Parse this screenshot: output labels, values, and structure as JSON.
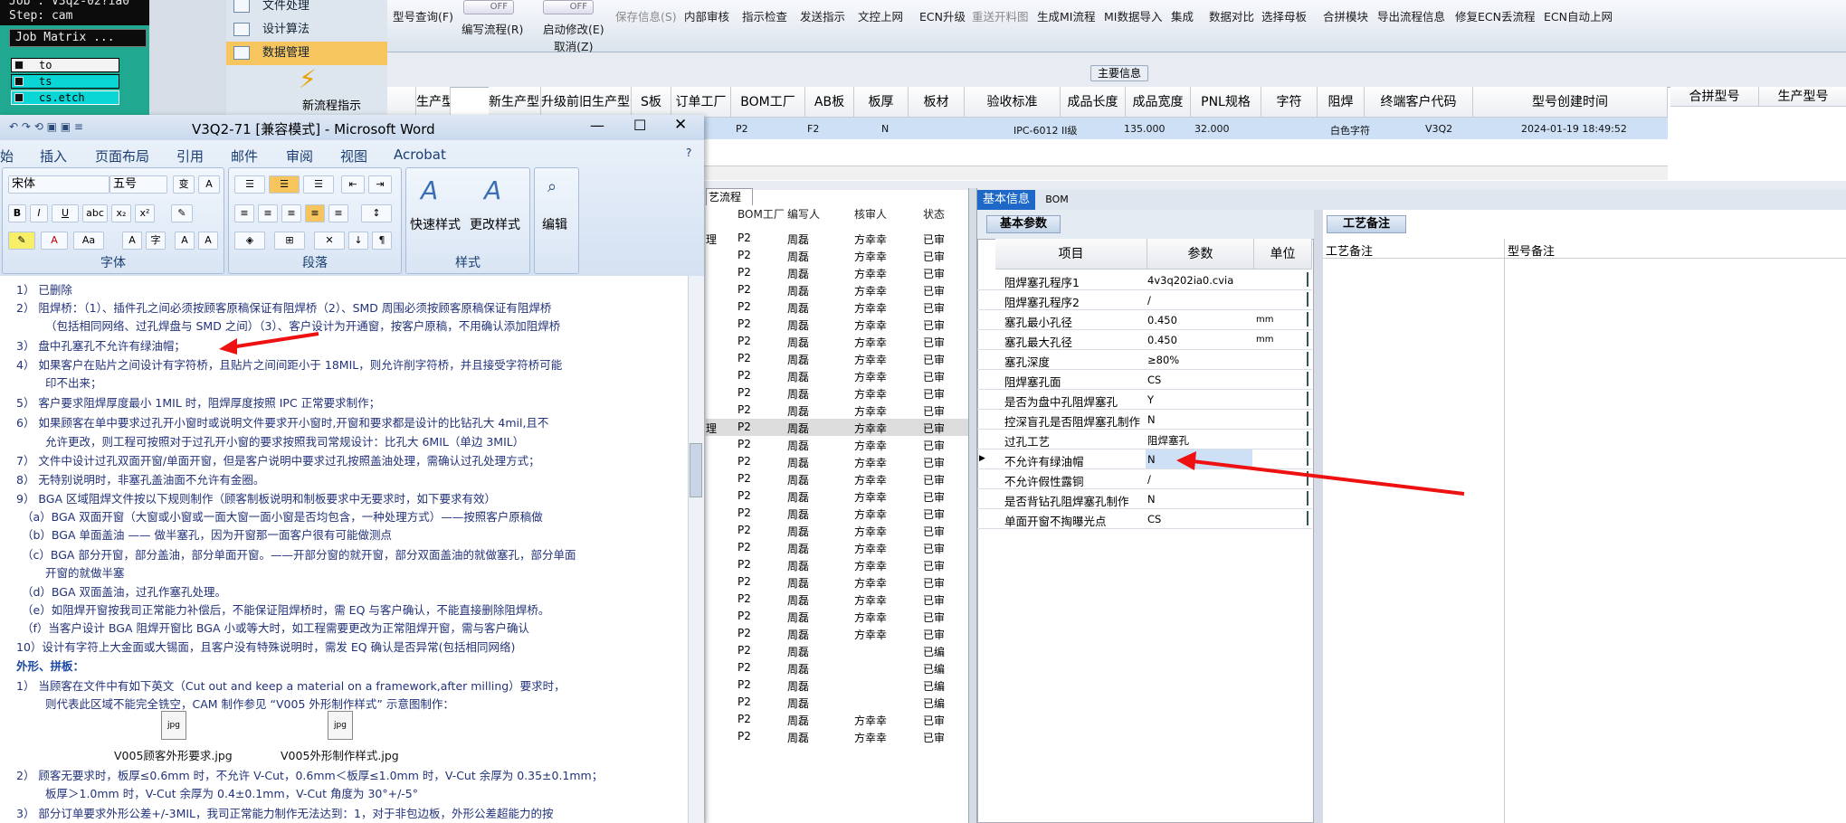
{
  "cam": {
    "job_line": "Job : V3q2-02?ia0",
    "step_line": "Step: cam",
    "job_matrix": "Job Matrix ...",
    "layers": [
      "to",
      "ts",
      "cs.etch"
    ]
  },
  "side_menu": {
    "items": [
      "文件处理",
      "设计算法",
      "数据管理"
    ],
    "new_flow": "新流程指示"
  },
  "toolbar": {
    "items": [
      {
        "label": "型号查询(F)",
        "disabled": false
      },
      {
        "label": "编写流程(R)",
        "disabled": false
      },
      {
        "label": "启动修改(E)\n取消(Z)",
        "disabled": false
      },
      {
        "label": "保存信息(S)",
        "disabled": true
      },
      {
        "label": "内部审核",
        "disabled": false
      },
      {
        "label": "指示检查",
        "disabled": false
      },
      {
        "label": "发送指示",
        "disabled": false
      },
      {
        "label": "文控上网",
        "disabled": false
      },
      {
        "label": "ECN升级",
        "disabled": false
      },
      {
        "label": "重送开料图",
        "disabled": true
      },
      {
        "label": "生成MI流程",
        "disabled": false
      },
      {
        "label": "MI数据导入",
        "disabled": false
      },
      {
        "label": "集成",
        "disabled": false
      },
      {
        "label": "数据对比",
        "disabled": false
      },
      {
        "label": "选择母板",
        "disabled": false
      },
      {
        "label": "合拼模块",
        "disabled": false
      },
      {
        "label": "导出流程信息",
        "disabled": false
      },
      {
        "label": "修复ECN丢流程",
        "disabled": false
      },
      {
        "label": "ECN自动上网",
        "disabled": false
      }
    ],
    "toggle_off": "OFF"
  },
  "main_info_label": "主要信息",
  "main_grid": {
    "headers": [
      "生产型号",
      "新生产型号",
      "升级前旧生产型号",
      "S板",
      "订单工厂",
      "BOM工厂",
      "AB板",
      "板厚",
      "板材",
      "验收标准",
      "成品长度",
      "成品宽度",
      "PNL规格",
      "字符",
      "阻焊",
      "终端客户代码",
      "型号创建时间"
    ],
    "right_headers": [
      "合拼型号",
      "生产型号"
    ],
    "row": {
      "s_board": "P2",
      "bom_factory": "F2",
      "ab": "N",
      "standard": "IPC-6012 II级",
      "length": "135.000",
      "width": "32.000",
      "character": "白色字符",
      "customer": "V3Q2",
      "created": "2024-01-19 18:49:52"
    }
  },
  "flow_list": {
    "tab": "艺流程",
    "headers": [
      "BOM工厂",
      "编写人",
      "核审人",
      "状态"
    ],
    "rows": [
      [
        "理",
        "P2",
        "周磊",
        "方幸幸",
        "已审"
      ],
      [
        "",
        "P2",
        "周磊",
        "方幸幸",
        "已审"
      ],
      [
        "",
        "P2",
        "周磊",
        "方幸幸",
        "已审"
      ],
      [
        "",
        "P2",
        "周磊",
        "方幸幸",
        "已审"
      ],
      [
        "",
        "P2",
        "周磊",
        "方幸幸",
        "已审"
      ],
      [
        "",
        "P2",
        "周磊",
        "方幸幸",
        "已审"
      ],
      [
        "",
        "P2",
        "周磊",
        "方幸幸",
        "已审"
      ],
      [
        "",
        "P2",
        "周磊",
        "方幸幸",
        "已审"
      ],
      [
        "",
        "P2",
        "周磊",
        "方幸幸",
        "已审"
      ],
      [
        "",
        "P2",
        "周磊",
        "方幸幸",
        "已审"
      ],
      [
        "",
        "P2",
        "周磊",
        "方幸幸",
        "已审"
      ],
      [
        "理",
        "P2",
        "周磊",
        "方幸幸",
        "已审"
      ],
      [
        "",
        "P2",
        "周磊",
        "方幸幸",
        "已审"
      ],
      [
        "",
        "P2",
        "周磊",
        "方幸幸",
        "已审"
      ],
      [
        "",
        "P2",
        "周磊",
        "方幸幸",
        "已审"
      ],
      [
        "",
        "P2",
        "周磊",
        "方幸幸",
        "已审"
      ],
      [
        "",
        "P2",
        "周磊",
        "方幸幸",
        "已审"
      ],
      [
        "",
        "P2",
        "周磊",
        "方幸幸",
        "已审"
      ],
      [
        "",
        "P2",
        "周磊",
        "方幸幸",
        "已审"
      ],
      [
        "",
        "P2",
        "周磊",
        "方幸幸",
        "已审"
      ],
      [
        "",
        "P2",
        "周磊",
        "方幸幸",
        "已审"
      ],
      [
        "",
        "P2",
        "周磊",
        "方幸幸",
        "已审"
      ],
      [
        "",
        "P2",
        "周磊",
        "方幸幸",
        "已审"
      ],
      [
        "",
        "P2",
        "周磊",
        "方幸幸",
        "已审"
      ],
      [
        "",
        "P2",
        "周磊",
        "",
        "已编"
      ],
      [
        "",
        "P2",
        "周磊",
        "",
        "已编"
      ],
      [
        "",
        "P2",
        "周磊",
        "",
        "已编"
      ],
      [
        "",
        "P2",
        "周磊",
        "",
        "已编"
      ],
      [
        "",
        "P2",
        "周磊",
        "方幸幸",
        "已审"
      ],
      [
        "",
        "P2",
        "周磊",
        "方幸幸",
        "已审"
      ]
    ]
  },
  "right_tabs": {
    "basic": "基本信息",
    "bom": "BOM"
  },
  "basic_params": {
    "subtab": "基本参数",
    "headers": [
      "项目",
      "参数",
      "单位"
    ],
    "rows": [
      {
        "k": "阻焊塞孔程序1",
        "v": "4v3q202ia0.cvia",
        "u": ""
      },
      {
        "k": "阻焊塞孔程序2",
        "v": "/",
        "u": ""
      },
      {
        "k": "塞孔最小孔径",
        "v": "0.450",
        "u": "mm"
      },
      {
        "k": "塞孔最大孔径",
        "v": "0.450",
        "u": "mm"
      },
      {
        "k": "塞孔深度",
        "v": "≥80%",
        "u": ""
      },
      {
        "k": "阻焊塞孔面",
        "v": "CS",
        "u": ""
      },
      {
        "k": "是否为盘中孔阻焊塞孔",
        "v": "Y",
        "u": ""
      },
      {
        "k": "控深盲孔是否阻焊塞孔制作",
        "v": "N",
        "u": ""
      },
      {
        "k": "过孔工艺",
        "v": "阻焊塞孔",
        "u": ""
      },
      {
        "k": "不允许有绿油帽",
        "v": "N",
        "u": ""
      },
      {
        "k": "不允许假性露铜",
        "v": "/",
        "u": ""
      },
      {
        "k": "是否背钻孔阻焊塞孔制作",
        "v": "N",
        "u": ""
      },
      {
        "k": "单面开窗不掏曝光点",
        "v": "CS",
        "u": ""
      }
    ]
  },
  "craft": {
    "tab": "工艺备注",
    "headers": [
      "工艺备注",
      "型号备注"
    ]
  },
  "word": {
    "title": "V3Q2-71 [兼容模式] - Microsoft Word",
    "tabs": [
      "始",
      "插入",
      "页面布局",
      "引用",
      "邮件",
      "审阅",
      "视图",
      "Acrobat"
    ],
    "font_name": "宋体",
    "font_size": "五号",
    "groups": [
      "字体",
      "段落",
      "样式"
    ],
    "style_buttons": [
      "快速样式",
      "更改样式",
      "编辑"
    ],
    "lines": [
      "1） 已删除",
      "2） 阻焊桥：（1）、插件孔之间必须按顾客原稿保证有阻焊桥（2）、SMD 周围必须按顾客原稿保证有阻焊桥",
      "（包括相同网络、过孔焊盘与 SMD 之间）（3）、客户设计为开通窗，按客户原稿，不用确认添加阻焊桥",
      "3） 盘中孔塞孔不允许有绿油帽；",
      "4） 如果客户在贴片之间设计有字符桥，且贴片之间间距小于 18MIL，则允许削字符桥，并且接受字符桥可能",
      "印不出来；",
      "5） 客户要求阻焊厚度最小 1MIL 时，阻焊厚度按照 IPC 正常要求制作；",
      "6） 如果顾客在单中要求过孔开小窗时或说明文件要求开小窗时,开窗和要求都是设计的比钻孔大 4mil,且不",
      "允许更改，则工程可按照对于过孔开小窗的要求按照我司常规设计：比孔大 6MIL（单边 3MIL）",
      "7） 文件中设计过孔双面开窗/单面开窗，但是客户说明中要求过孔按照盖油处理，需确认过孔处理方式；",
      "8） 无特别说明时，非塞孔盖油面不允许有金圈。",
      "9） BGA 区域阻焊文件按以下规则制作（顾客制板说明和制板要求中无要求时，如下要求有效）",
      "（a）BGA 双面开窗（大窗或小窗或一面大窗一面小窗是否均包含，一种处理方式）——按照客户原稿做",
      "（b）BGA 单面盖油 —— 做半塞孔，因为开窗那一面客户很有可能做测点",
      "（c）BGA 部分开窗，部分盖油，部分单面开窗。——开部分窗的就开窗，部分双面盖油的就做塞孔，部分单面",
      "开窗的就做半塞",
      "（d）BGA 双面盖油，过孔作塞孔处理。",
      "（e）如阻焊开窗按我司正常能力补偿后，不能保证阻焊桥时，需 EQ 与客户确认，不能直接删除阻焊桥。",
      "（f）当客户设计 BGA 阻焊开窗比 BGA 小或等大时，如工程需要更改为正常阻焊开窗，需与客户确认",
      "10）设计有字符上大金面或大锡面，且客户没有特殊说明时，需发 EQ 确认是否异常(包括相同网络)",
      "外形、拼板：",
      "1） 当顾客在文件中有如下英文（Cut out and keep a material on a framework,after milling）要求时，",
      "则代表此区域不能完全铣空，CAM 制作参见 “V005 外形制作样式” 示意图制作：",
      "V005顾客外形要求.jpg",
      "V005外形制作样式.jpg",
      "2） 顾客无要求时，板厚≤0.6mm 时，不允许 V-Cut，0.6mm＜板厚≤1.0mm 时，V-Cut 余厚为 0.35±0.1mm；",
      "板厚＞1.0mm 时，V-Cut 余厚为 0.4±0.1mm，V-Cut 角度为 30°+/-5°",
      "3） 部分订单要求外形公差+/-3MIL，我司正常能力制作无法达到：1，对于非包边板，外形公差超能力的按"
    ]
  }
}
